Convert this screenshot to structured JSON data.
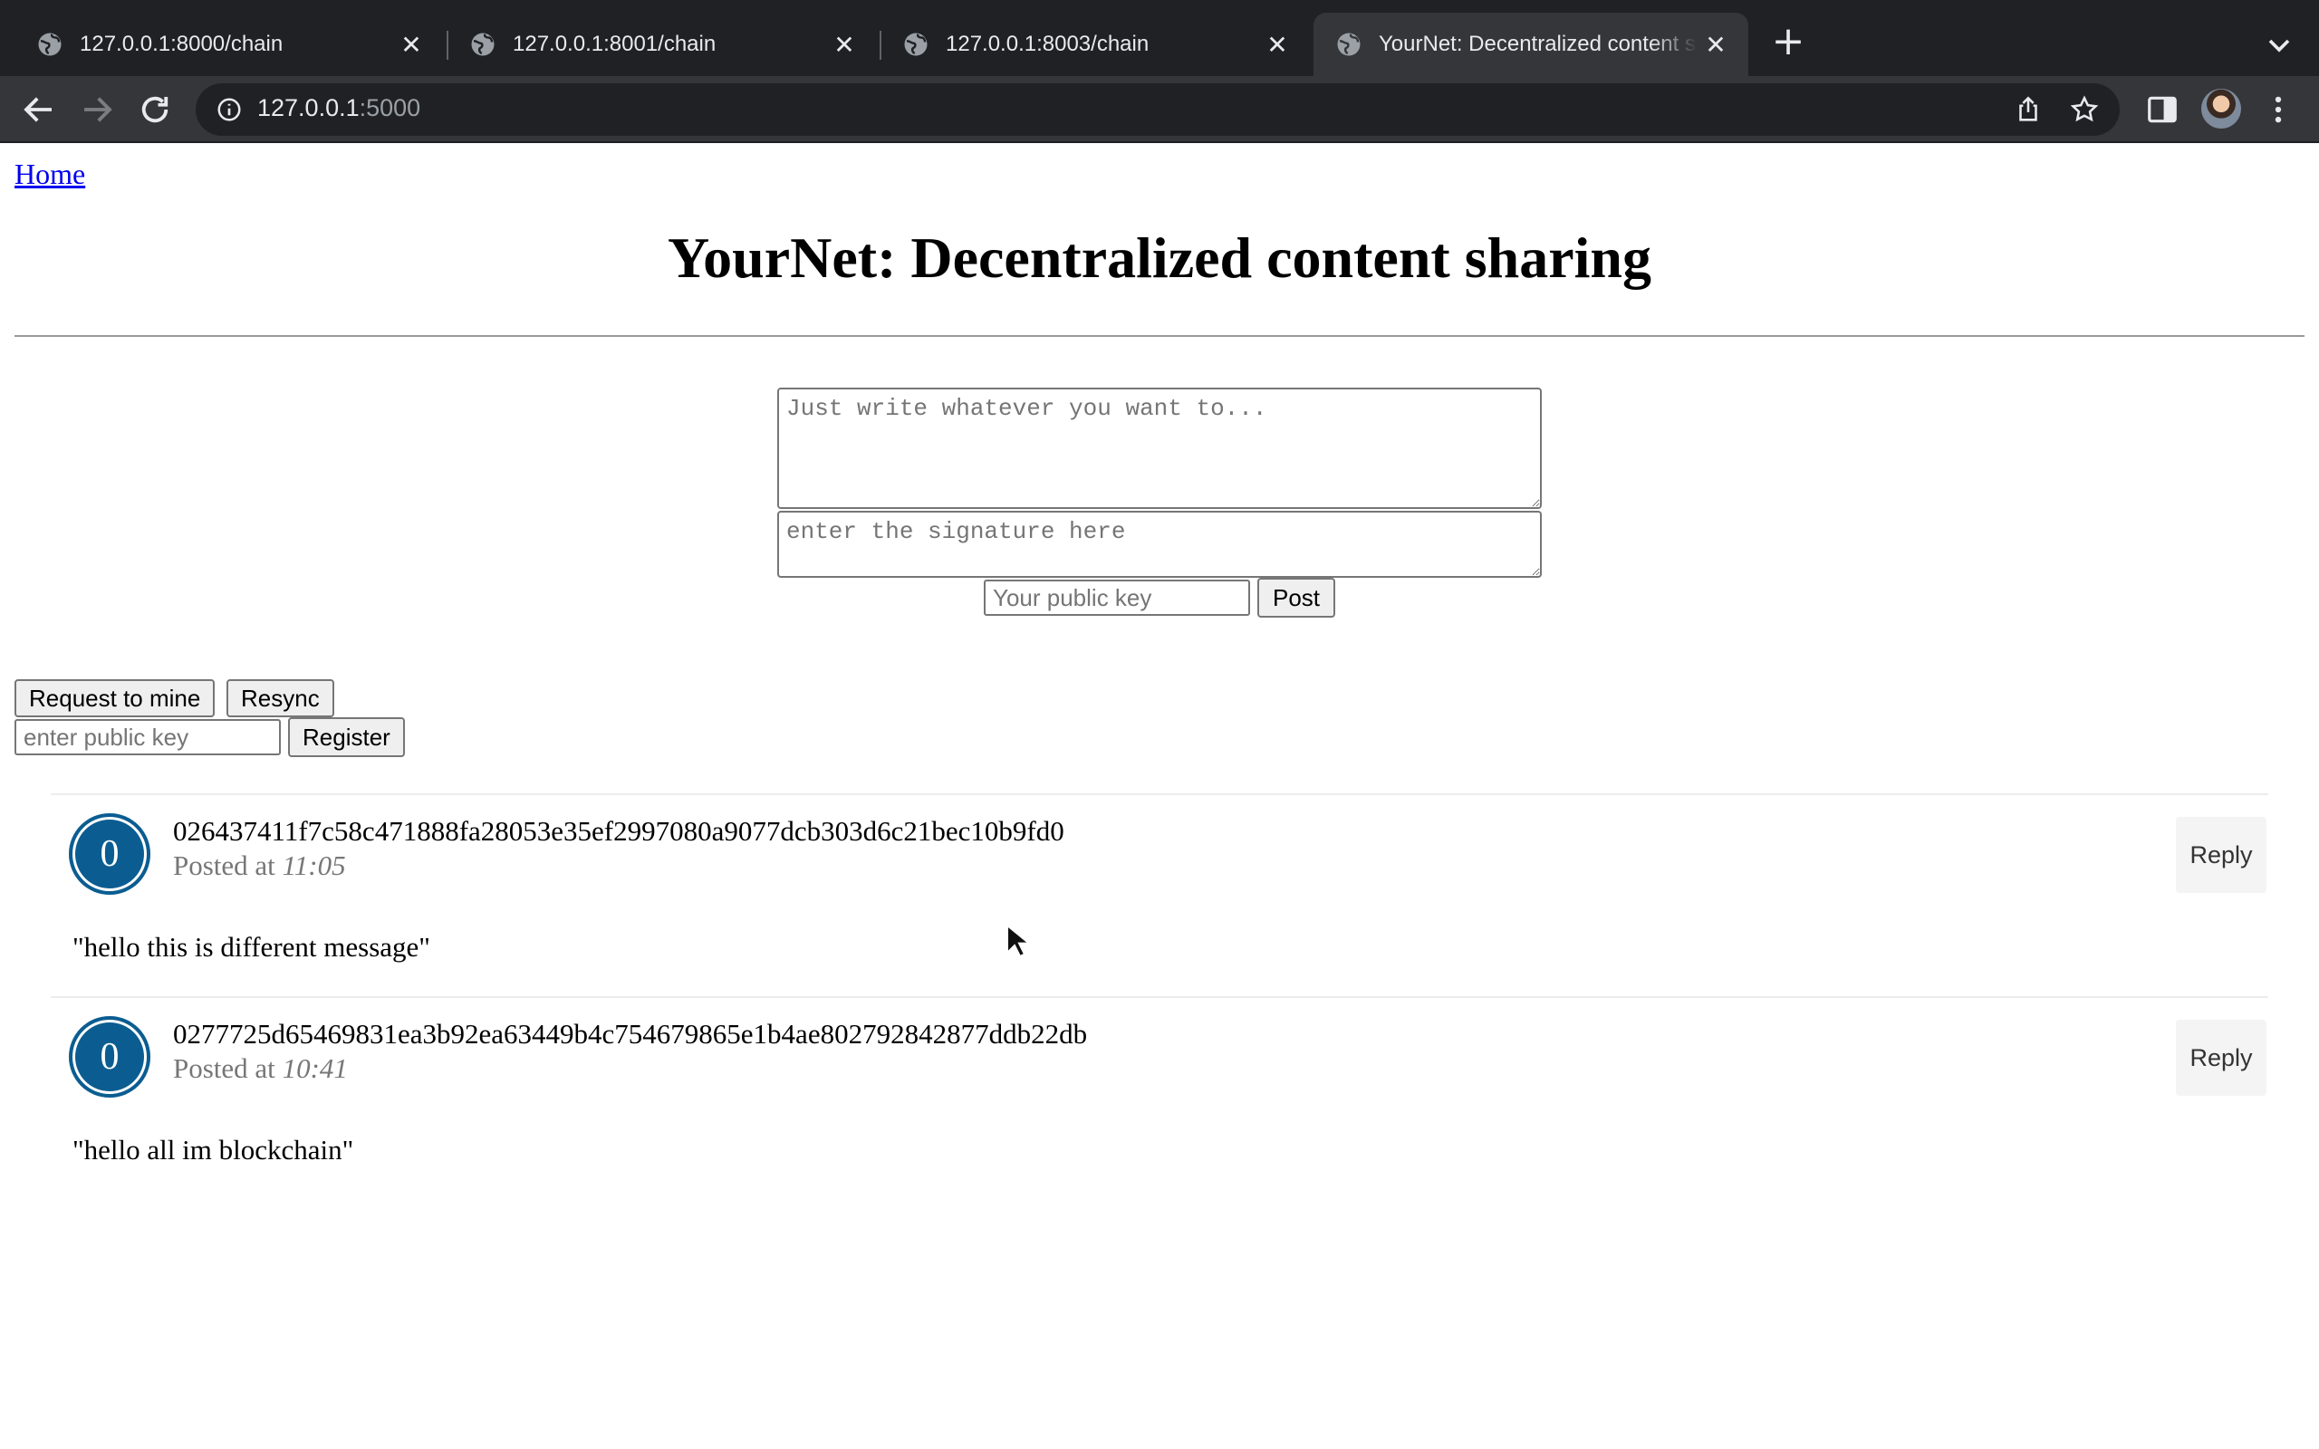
{
  "browser": {
    "tabs": [
      {
        "title": "127.0.0.1:8000/chain",
        "active": false
      },
      {
        "title": "127.0.0.1:8001/chain",
        "active": false
      },
      {
        "title": "127.0.0.1:8003/chain",
        "active": false
      },
      {
        "title": "YourNet: Decentralized content sharing",
        "active": true
      }
    ],
    "address": {
      "host": "127.0.0.1",
      "port": ":5000"
    }
  },
  "page": {
    "home_link": "Home",
    "title": "YourNet: Decentralized content sharing",
    "compose": {
      "content_placeholder": "Just write whatever you want to...",
      "signature_placeholder": "enter the signature here",
      "public_key_placeholder": "Your public key",
      "post_label": "Post"
    },
    "actions": {
      "mine_label": "Request to mine",
      "resync_label": "Resync",
      "register_placeholder": "enter public key",
      "register_label": "Register"
    },
    "posts": [
      {
        "avatar": "0",
        "author": "026437411f7c58c471888fa28053e35ef2997080a9077dcb303d6c21bec10b9fd0",
        "posted_prefix": "Posted at",
        "time": "11:05",
        "content": "\"hello this is different message\"",
        "reply_label": "Reply"
      },
      {
        "avatar": "0",
        "author": "0277725d65469831ea3b92ea63449b4c754679865e1b4ae802792842877ddb22db",
        "posted_prefix": "Posted at",
        "time": "10:41",
        "content": "\"hello all im blockchain\"",
        "reply_label": "Reply"
      }
    ]
  },
  "colors": {
    "avatar_bg": "#0b5d91",
    "link": "#0000ee",
    "chrome_bg": "#202124",
    "toolbar_bg": "#35363a"
  },
  "icons": [
    "globe-icon",
    "close-icon",
    "new-tab-icon",
    "tab-search-icon",
    "back-icon",
    "forward-icon",
    "reload-icon",
    "info-icon",
    "share-icon",
    "bookmark-star-icon",
    "side-panel-icon",
    "profile-avatar",
    "kebab-menu-icon"
  ]
}
